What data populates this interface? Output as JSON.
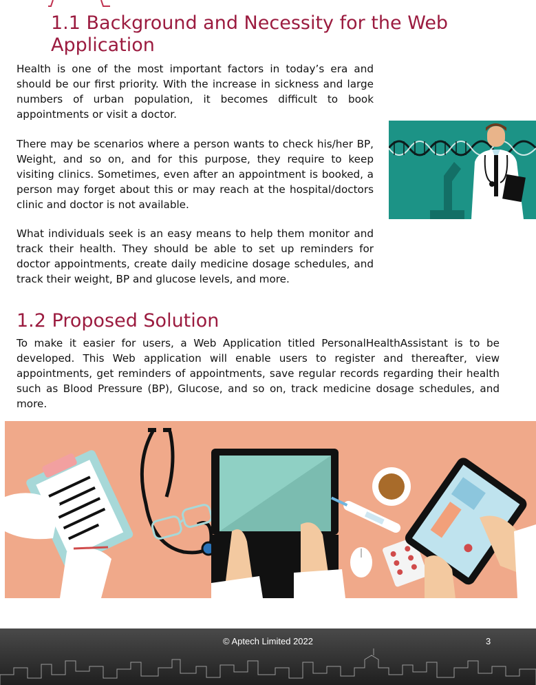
{
  "section1": {
    "heading": "1.1 Background and Necessity for the Web Application",
    "paragraphs": [
      "Health is one of the most important factors in today’s era and should be our first priority. With the increase in sickness and large numbers of urban population, it becomes difficult to book appointments or visit a doctor.",
      "There may be scenarios where a person wants to check his/her BP, Weight, and so on, and for this purpose, they require to keep visiting clinics. Sometimes, even after an appointment is booked, a person may forget about this or may reach at the hospital/doctors clinic and doctor is not available.",
      "What individuals seek is an easy means to help them  monitor and track their health. They should be able to set up reminders for doctor appointments, create daily medicine dosage schedules, and track their weight, BP and glucose levels, and more."
    ]
  },
  "section2": {
    "heading": "1.2 Proposed Solution",
    "paragraph": "To make it easier for users, a Web Application titled PersonalHealthAssistant is to be developed. This Web application will enable users to register and thereafter, view appointments, get reminders of appointments, save regular records regarding their health such as Blood Pressure (BP), Glucose, and so on, track medicine dosage schedules, and more."
  },
  "footer": {
    "copyright": "© Aptech Limited 2022",
    "page_number": "3"
  },
  "colors": {
    "heading": "#9b1b3f",
    "doctor_bg": "#1f9a8c",
    "desk_bg": "#f0a98a"
  }
}
